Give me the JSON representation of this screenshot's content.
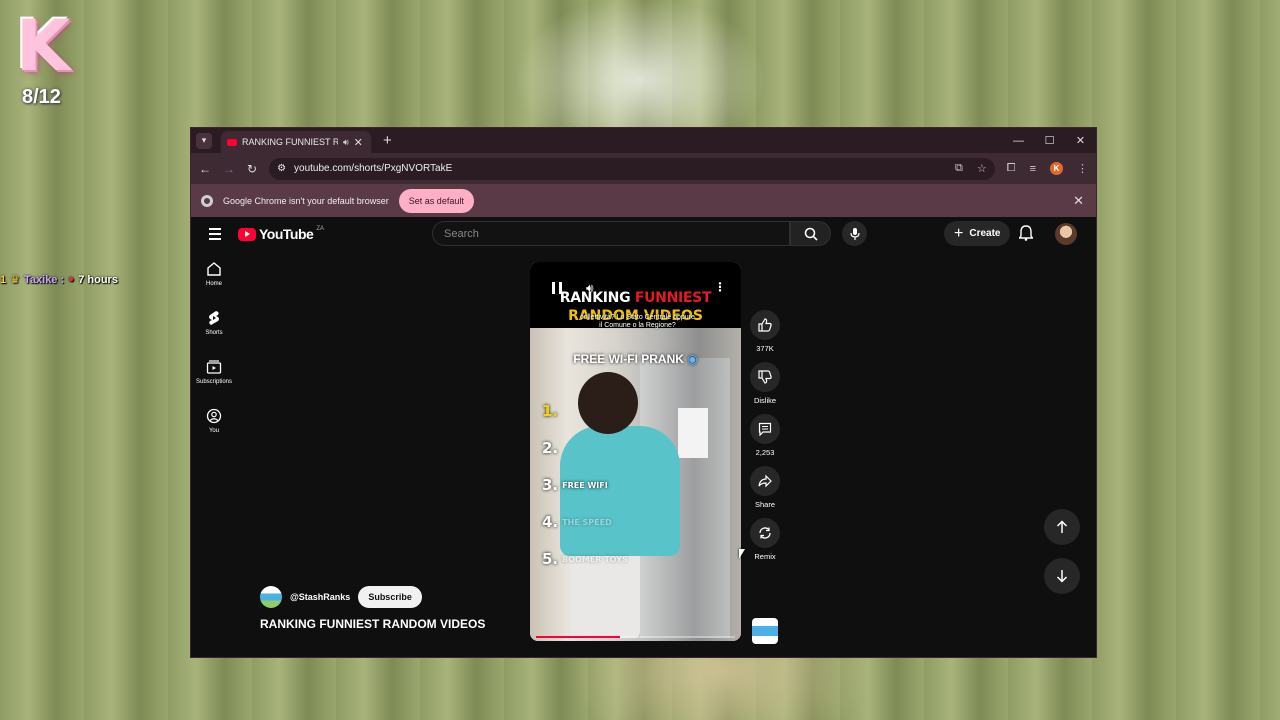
{
  "overlay": {
    "counter": "8/12",
    "chat": {
      "badge": "1",
      "user": "Taxike :",
      "message": "7 hours"
    }
  },
  "browser": {
    "tab_title": "RANKING FUNNIEST RAND",
    "url": "youtube.com/shorts/PxgNVORTakE",
    "infobar_text": "Google Chrome isn't your default browser",
    "set_default_label": "Set as default",
    "profile_initial": "K"
  },
  "youtube": {
    "logo_text": "YouTube",
    "country_code": "ZA",
    "search_placeholder": "Search",
    "create_label": "Create",
    "sidebar": [
      {
        "label": "Home",
        "icon": "home-icon"
      },
      {
        "label": "Shorts",
        "icon": "shorts-icon"
      },
      {
        "label": "Subscriptions",
        "icon": "subscriptions-icon"
      },
      {
        "label": "You",
        "icon": "you-icon"
      }
    ],
    "short": {
      "overlay_title_white": "RANKING",
      "overlay_title_red": "FUNNIEST",
      "overlay_title_line2": "RANDOM VIDEOS",
      "caption_line1": "collettività? Lo Stato Centrale oppure",
      "caption_line2": "il Comune o la Regione?",
      "scene_title": "FREE WI-FI PRANK",
      "ranks": [
        {
          "num": "1.",
          "text": ""
        },
        {
          "num": "2.",
          "text": ""
        },
        {
          "num": "3.",
          "text": "FREE WIFI"
        },
        {
          "num": "4.",
          "text": "THE SPEED"
        },
        {
          "num": "5.",
          "text": "BOOMER TOYS"
        }
      ],
      "progress": 0.42
    },
    "actions": [
      {
        "label": "377K",
        "icon": "like-icon"
      },
      {
        "label": "Dislike",
        "icon": "dislike-icon"
      },
      {
        "label": "2,253",
        "icon": "comment-icon"
      },
      {
        "label": "Share",
        "icon": "share-icon"
      },
      {
        "label": "Remix",
        "icon": "remix-icon"
      }
    ],
    "channel": "@StashRanks",
    "subscribe_label": "Subscribe",
    "video_title": "RANKING FUNNIEST RANDOM VIDEOS"
  }
}
